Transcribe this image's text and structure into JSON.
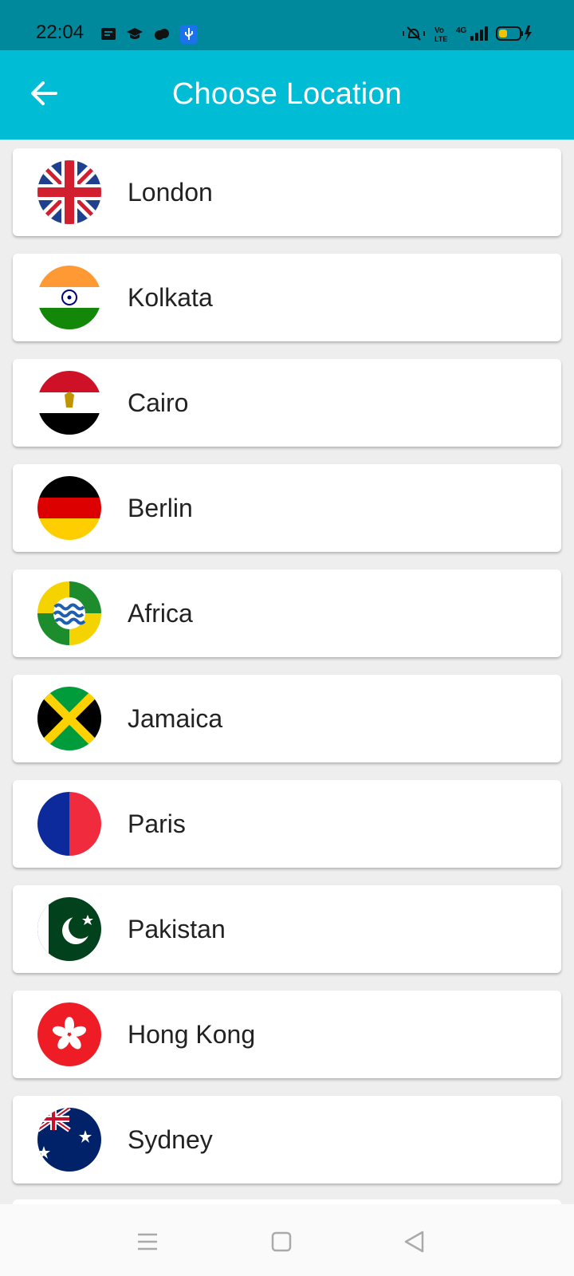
{
  "status_bar": {
    "time": "22:04",
    "left_icons": [
      "message-icon",
      "graduation-cap-icon",
      "cloud-icon",
      "usb-icon"
    ],
    "right_icons": [
      "vibrate-mute-icon",
      "volte-icon",
      "4g-signal-icon",
      "battery-charging-icon"
    ]
  },
  "app_bar": {
    "title": "Choose Location",
    "back_icon": "arrow-left-icon",
    "background": "#00bcd4"
  },
  "locations": [
    {
      "name": "London",
      "flag": "uk-flag-icon"
    },
    {
      "name": "Kolkata",
      "flag": "india-flag-icon"
    },
    {
      "name": "Cairo",
      "flag": "egypt-flag-icon"
    },
    {
      "name": "Berlin",
      "flag": "germany-flag-icon"
    },
    {
      "name": "Africa",
      "flag": "africa-flag-icon"
    },
    {
      "name": "Jamaica",
      "flag": "jamaica-flag-icon"
    },
    {
      "name": "Paris",
      "flag": "france-flag-icon"
    },
    {
      "name": "Pakistan",
      "flag": "pakistan-flag-icon"
    },
    {
      "name": "Hong Kong",
      "flag": "hong-kong-flag-icon"
    },
    {
      "name": "Sydney",
      "flag": "australia-flag-icon"
    }
  ],
  "nav_bar": {
    "buttons": [
      "menu-icon",
      "home-square-icon",
      "back-triangle-icon"
    ]
  }
}
